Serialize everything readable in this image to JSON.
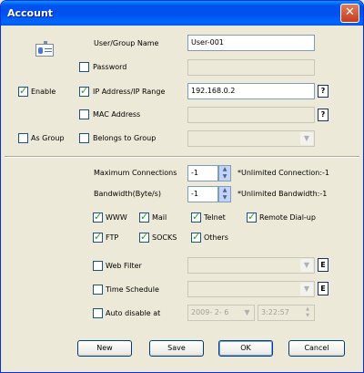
{
  "window": {
    "title": "Account",
    "close_glyph": "✕"
  },
  "labels": {
    "user_group_name": "User/Group Name",
    "password": "Password",
    "enable": "Enable",
    "ip_range": "IP Address/IP Range",
    "mac": "MAC Address",
    "as_group": "As Group",
    "belongs_group": "Belongs to Group",
    "max_conn": "Maximum Connections",
    "bandwidth": "Bandwidth(Byte/s)",
    "unlimited_conn": "*Unlimited Connection:-1",
    "unlimited_bw": "*Unlimited Bandwidth:-1",
    "web_filter": "Web Filter",
    "time_schedule": "Time Schedule",
    "auto_disable": "Auto disable at"
  },
  "fields": {
    "user_name": "User-001",
    "password": "",
    "ip": "192.168.0.2",
    "mac": "",
    "max_conn": "-1",
    "bandwidth": "-1",
    "date": "2009- 2- 6",
    "time": "3:22:57"
  },
  "checks": {
    "password": false,
    "enable": true,
    "ip": true,
    "mac": false,
    "as_group": false,
    "belongs": false,
    "web_filter": false,
    "time_schedule": false,
    "auto_disable": false
  },
  "protocols": [
    {
      "label": "WWW",
      "checked": true
    },
    {
      "label": "Mail",
      "checked": true
    },
    {
      "label": "Telnet",
      "checked": true
    },
    {
      "label": "Remote Dial-up",
      "checked": true
    },
    {
      "label": "FTP",
      "checked": true
    },
    {
      "label": "SOCKS",
      "checked": true
    },
    {
      "label": "Others",
      "checked": true
    }
  ],
  "glyphs": {
    "help": "?",
    "edit": "E",
    "up": "▲",
    "down": "▼",
    "dropdown": "▼"
  },
  "buttons": {
    "new": "New",
    "save": "Save",
    "ok": "OK",
    "cancel": "Cancel"
  },
  "icons": {
    "account": "user-card-icon"
  }
}
